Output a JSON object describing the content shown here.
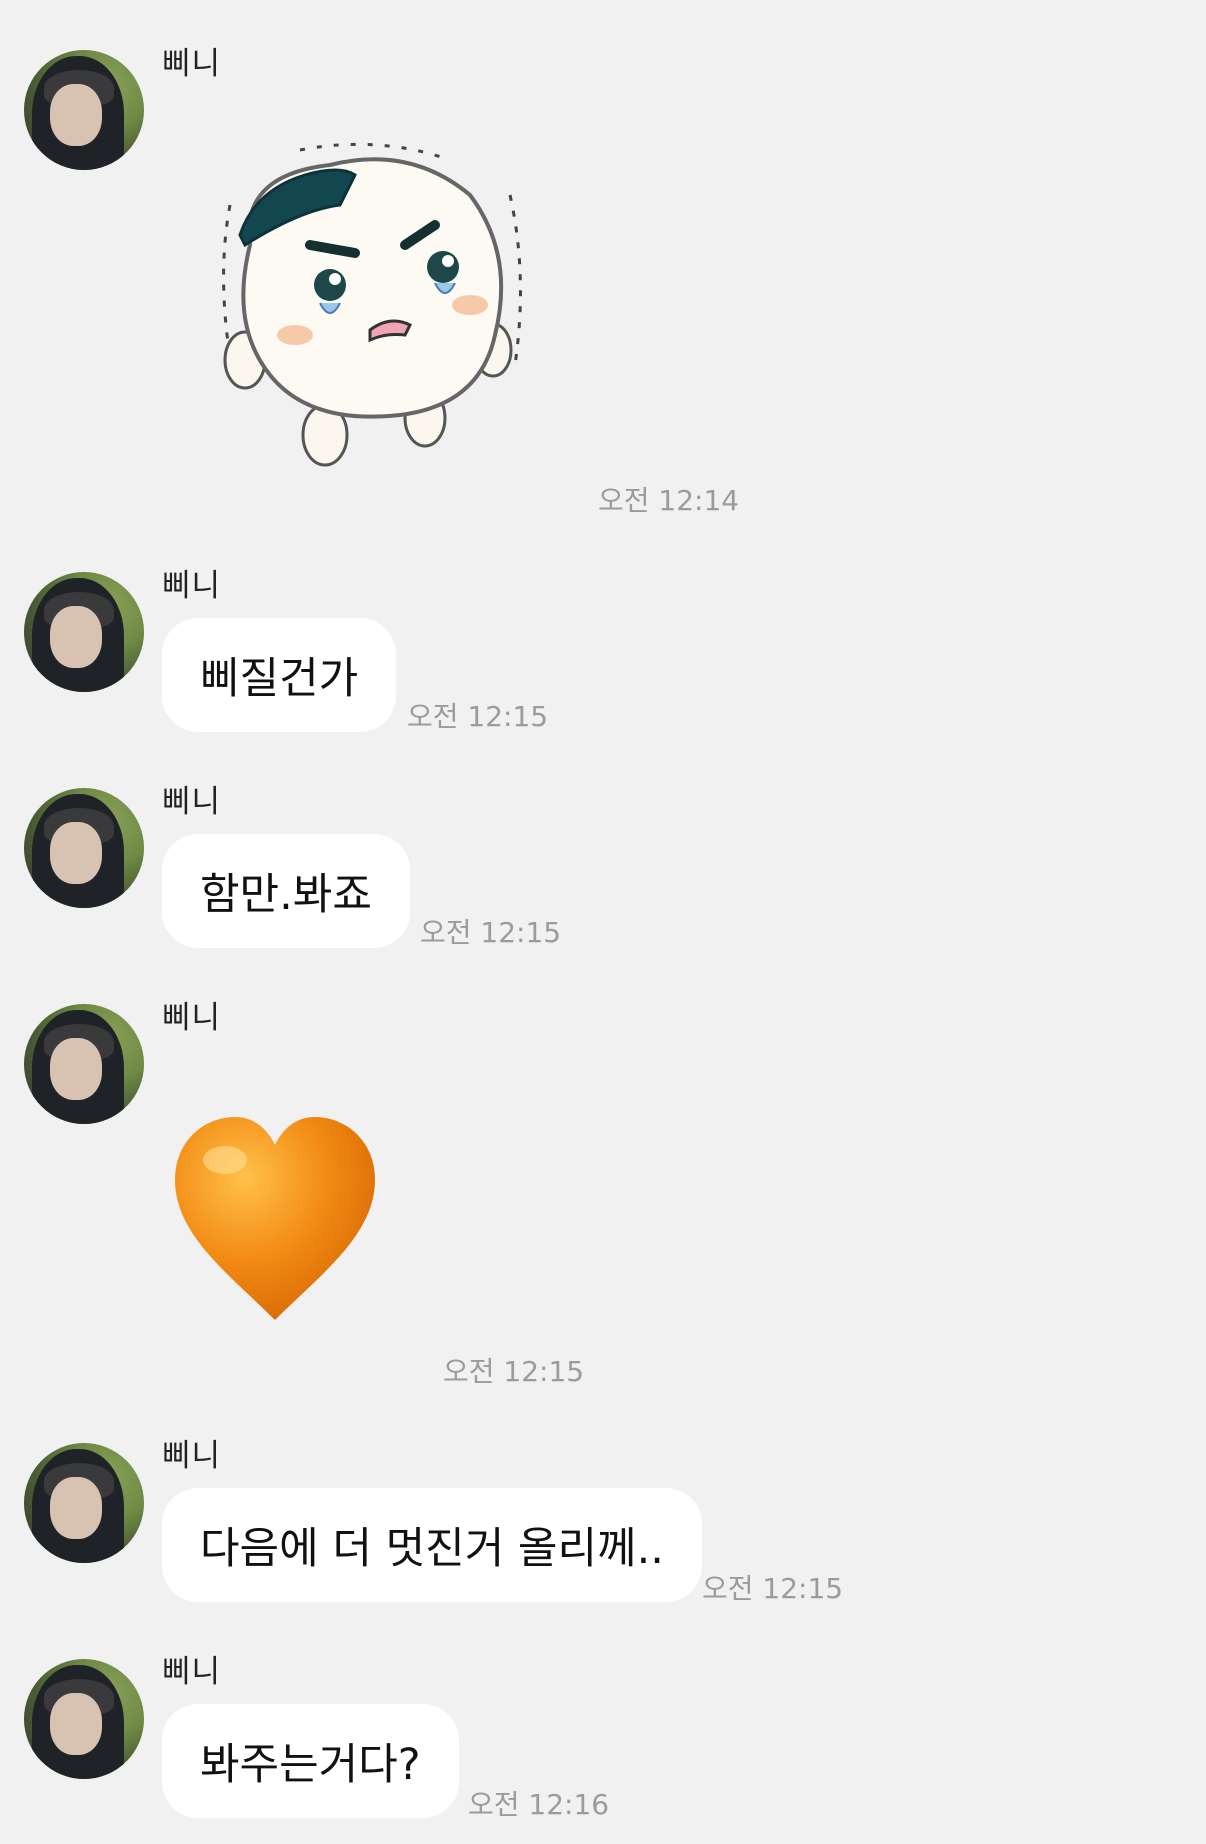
{
  "sender": "삐니",
  "messages": [
    {
      "type": "sticker",
      "sticker": "crying-rice-ball-sticker",
      "time": "오전 12:14"
    },
    {
      "type": "text",
      "text": "삐질건가",
      "time": "오전 12:15"
    },
    {
      "type": "text",
      "text": "함만.봐죠",
      "time": "오전 12:15"
    },
    {
      "type": "emoji",
      "emoji": "orange-heart-icon",
      "time": "오전 12:15"
    },
    {
      "type": "text",
      "text": "다음에 더 멋진거 올리께..",
      "time": "오전 12:15"
    },
    {
      "type": "text",
      "text": "봐주는거다?",
      "time": "오전 12:16"
    }
  ],
  "colors": {
    "background": "#f1f1f1",
    "bubble": "#ffffff",
    "timestamp": "#9b9b9b",
    "heart": "#f28a13"
  }
}
